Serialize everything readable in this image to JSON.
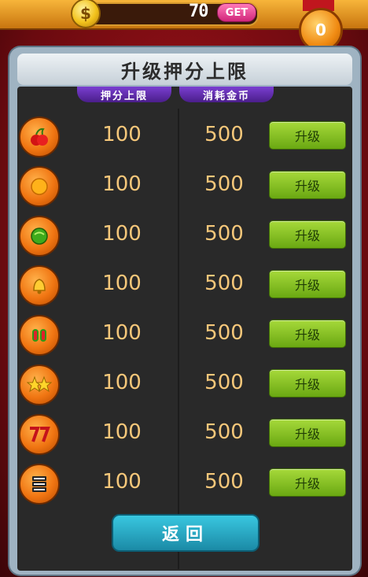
{
  "header": {
    "coin_symbol": "$",
    "coin_value": "70",
    "get_label": "GET",
    "badge_value": "0"
  },
  "panel": {
    "title": "升级押分上限",
    "col_limit": "押分上限",
    "col_cost": "消耗金币"
  },
  "rows": [
    {
      "icon": "cherry-icon",
      "limit": "100",
      "cost": "500",
      "button": "升级"
    },
    {
      "icon": "orange-icon",
      "limit": "100",
      "cost": "500",
      "button": "升级"
    },
    {
      "icon": "melon-icon",
      "limit": "100",
      "cost": "500",
      "button": "升级"
    },
    {
      "icon": "bell-icon",
      "limit": "100",
      "cost": "500",
      "button": "升级"
    },
    {
      "icon": "watermelon-icon",
      "limit": "100",
      "cost": "500",
      "button": "升级"
    },
    {
      "icon": "star-icon",
      "limit": "100",
      "cost": "500",
      "button": "升级"
    },
    {
      "icon": "seven-icon",
      "limit": "100",
      "cost": "500",
      "button": "升级"
    },
    {
      "icon": "bar-icon",
      "limit": "100",
      "cost": "500",
      "button": "升级"
    }
  ],
  "return_label": "返回"
}
